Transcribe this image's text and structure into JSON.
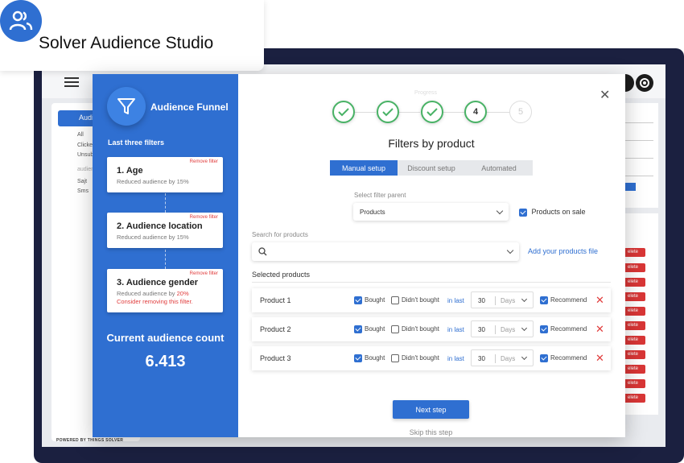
{
  "app": {
    "title": "Solver Audience Studio",
    "powered_by": "POWERED BY THINGS SOLVER"
  },
  "background": {
    "sidebar_active": "Audie",
    "sidebar_items": [
      "All",
      "Clicke",
      "Unsub",
      "audien",
      "Sajt",
      "Sms"
    ],
    "delete_label": "elete"
  },
  "funnel": {
    "title": "Audience Funnel",
    "last_filters_label": "Last three filters",
    "filters": [
      {
        "title": "1. Age",
        "remove": "Remove filter",
        "sub_prefix": "Reduced audience by 15%",
        "sub_highlight": "",
        "warning": ""
      },
      {
        "title": "2. Audience location",
        "remove": "Remove filter",
        "sub_prefix": "Reduced audience by 15%",
        "sub_highlight": "",
        "warning": ""
      },
      {
        "title": "3. Audience gender",
        "remove": "Remove filter",
        "sub_prefix": "Reduced audience by ",
        "sub_highlight": "20%",
        "warning": "Consider removing this filter."
      }
    ],
    "count_label": "Current audience count",
    "count_value": "6.413"
  },
  "progress": {
    "label": "Progress",
    "current_step": "4",
    "next_step": "5"
  },
  "main": {
    "title": "Filters by product",
    "tabs": [
      "Manual setup",
      "Discount setup",
      "Automated"
    ],
    "filter_parent_label": "Select filter parent",
    "filter_parent_value": "Products",
    "products_on_sale": "Products on sale",
    "search_label": "Search for products",
    "add_file_link": "Add your products file",
    "selected_products_label": "Selected products"
  },
  "products": [
    {
      "name": "Product 1",
      "bought": "Bought",
      "didnt": "Didn't bought",
      "in_last": "in last",
      "days": "30",
      "unit": "Days",
      "recommend": "Recommend"
    },
    {
      "name": "Product 2",
      "bought": "Bought",
      "didnt": "Didn't bought",
      "in_last": "in last",
      "days": "30",
      "unit": "Days",
      "recommend": "Recommend"
    },
    {
      "name": "Product 3",
      "bought": "Bought",
      "didnt": "Didn't bought",
      "in_last": "in last",
      "days": "30",
      "unit": "Days",
      "recommend": "Recommend"
    }
  ],
  "actions": {
    "next": "Next step",
    "skip": "Skip this step"
  },
  "colors": {
    "accent": "#2f6fd1",
    "success": "#48b265",
    "danger": "#e03c3c",
    "frame": "#1b2040"
  }
}
